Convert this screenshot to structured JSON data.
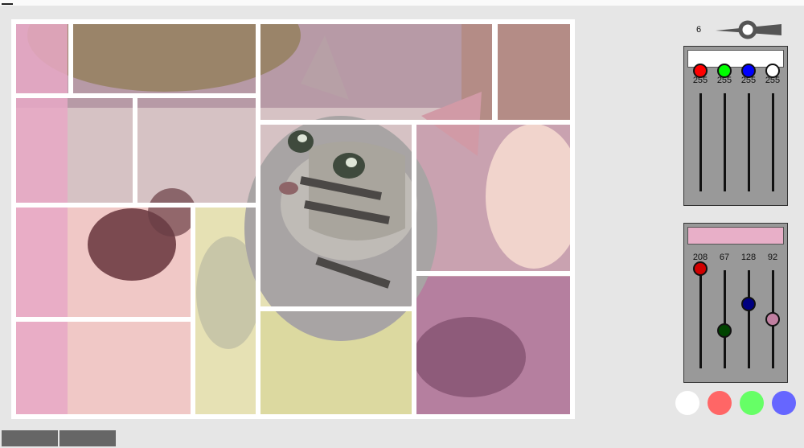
{
  "stroke": {
    "value": "6",
    "level": 0.5
  },
  "fill_mixer": {
    "swatch_color": "#ffffff",
    "channels": [
      {
        "name": "red",
        "value": "255",
        "knob_color": "#ff0000"
      },
      {
        "name": "green",
        "value": "255",
        "knob_color": "#00ff00"
      },
      {
        "name": "blue",
        "value": "255",
        "knob_color": "#0000ff"
      },
      {
        "name": "alpha",
        "value": "255",
        "knob_color": "#ffffff"
      }
    ]
  },
  "stroke_mixer": {
    "swatch_color": "#e8afc8",
    "channels": [
      {
        "name": "red",
        "value": "208",
        "knob_color": "#d10000"
      },
      {
        "name": "green",
        "value": "67",
        "knob_color": "#004400"
      },
      {
        "name": "blue",
        "value": "128",
        "knob_color": "#000080"
      },
      {
        "name": "alpha",
        "value": "92",
        "knob_color": "#c07fa0"
      }
    ]
  },
  "presets": [
    {
      "name": "white",
      "color": "#ffffff"
    },
    {
      "name": "red",
      "color": "#ff6666"
    },
    {
      "name": "green",
      "color": "#66ff66"
    },
    {
      "name": "blue",
      "color": "#6666ff"
    }
  ],
  "colors": {
    "background": "#e6e6e6",
    "panel": "#999999",
    "frame": "#ffffff",
    "tab": "#666666"
  }
}
